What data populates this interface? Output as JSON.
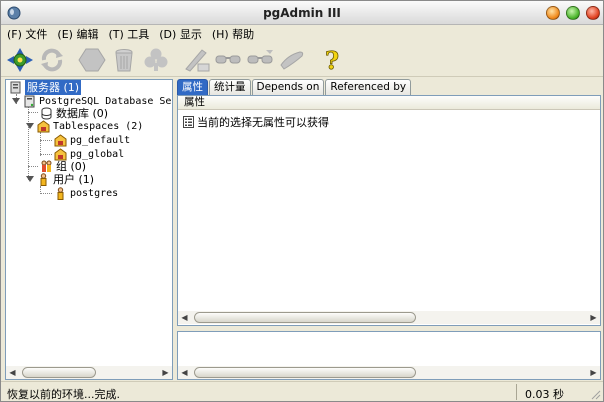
{
  "window": {
    "title": "pgAdmin III"
  },
  "menu": [
    {
      "label": "(F) 文件"
    },
    {
      "label": "(E) 编辑"
    },
    {
      "label": "(T) 工具"
    },
    {
      "label": "(D) 显示"
    },
    {
      "label": "(H) 帮助"
    }
  ],
  "toolbar": {
    "icons": [
      "connect-icon",
      "refresh-icon",
      "object-icon",
      "delete-icon",
      "properties-icon",
      "sql-icon",
      "view-data-icon",
      "filter-data-icon",
      "maintenance-icon",
      "help-icon"
    ]
  },
  "tree": {
    "root": "服务器 (1)",
    "server": "PostgreSQL Database Server",
    "databases": "数据库 (0)",
    "tablespaces": "Tablespaces (2)",
    "ts_default": "pg_default",
    "ts_global": "pg_global",
    "groups": "组 (0)",
    "users": "用户 (1)",
    "user_postgres": "postgres"
  },
  "tabs": [
    {
      "label": "属性",
      "active": true
    },
    {
      "label": "统计量",
      "active": false
    },
    {
      "label": "Depends on",
      "active": false
    },
    {
      "label": "Referenced by",
      "active": false
    }
  ],
  "properties": {
    "column_header": "属性",
    "message": "当前的选择无属性可以获得"
  },
  "status": {
    "message": "恢复以前的环境...完成.",
    "elapsed": "0.03 秒"
  },
  "colors": {
    "selection": "#316ac5",
    "window_bg": "#ece9d8",
    "border": "#7f9db9"
  }
}
